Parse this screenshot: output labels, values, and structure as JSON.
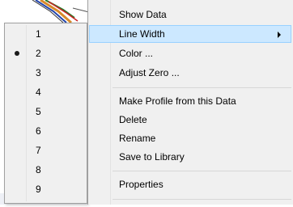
{
  "submenu": {
    "options": [
      {
        "label": "1",
        "selected": false
      },
      {
        "label": "2",
        "selected": true
      },
      {
        "label": "3",
        "selected": false
      },
      {
        "label": "4",
        "selected": false
      },
      {
        "label": "5",
        "selected": false
      },
      {
        "label": "6",
        "selected": false
      },
      {
        "label": "7",
        "selected": false
      },
      {
        "label": "8",
        "selected": false
      },
      {
        "label": "9",
        "selected": false
      }
    ]
  },
  "context_menu": {
    "items": [
      {
        "label": "Show Data"
      },
      {
        "label": "Line Width",
        "has_submenu": true,
        "highlighted": true
      },
      {
        "label": "Color ..."
      },
      {
        "label": "Adjust Zero ..."
      },
      {
        "label": "Make Profile from this Data"
      },
      {
        "label": "Delete"
      },
      {
        "label": "Rename"
      },
      {
        "label": "Save to Library"
      },
      {
        "label": "Properties"
      }
    ]
  },
  "colors": {
    "menu_background": "#f0f0f0",
    "highlight_background": "#cce8ff",
    "highlight_border": "#99d1ff",
    "menu_border": "#a0a0a0"
  }
}
